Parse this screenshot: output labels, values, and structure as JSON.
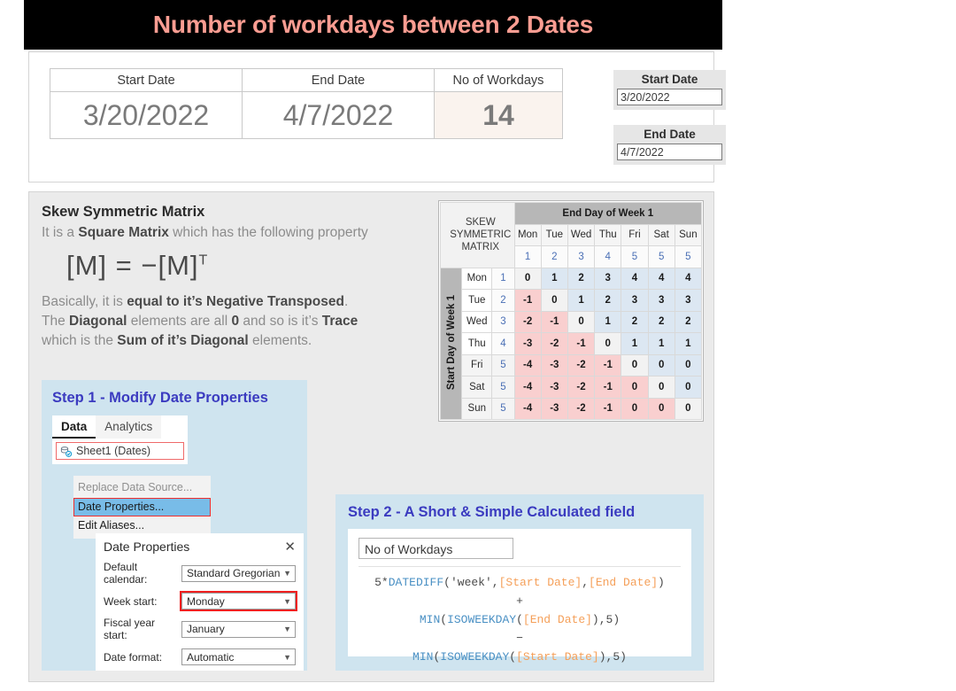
{
  "title": "Number of workdays between 2 Dates",
  "summary": {
    "headers": [
      "Start Date",
      "End Date",
      "No of Workdays"
    ],
    "values": [
      "3/20/2022",
      "4/7/2022",
      "14"
    ],
    "workdays_bg": "#faf3ee",
    "workdays_color": "#d58080"
  },
  "parameters": [
    {
      "name": "param-start-date",
      "label": "Start Date",
      "value": "3/20/2022"
    },
    {
      "name": "param-end-date",
      "label": "End Date",
      "value": "4/7/2022"
    }
  ],
  "explanation": {
    "heading": "Skew Symmetric Matrix",
    "line1_a": "It is a ",
    "line1_b": "Square Matrix",
    "line1_c": " which has the following property",
    "formula_left": "[M]  =  −[M]",
    "formula_sup": "T",
    "line2_a": "Basically, it is ",
    "line2_b": "equal to it’s Negative Transposed",
    "line2_c": ".",
    "line3_a": "The ",
    "line3_b": "Diagonal",
    "line3_c": " elements are all ",
    "line3_d": "0",
    "line3_e": " and so is it’s ",
    "line3_f": "Trace",
    "line4_a": "which is the ",
    "line4_b": "Sum of it’s Diagonal",
    "line4_c": " elements."
  },
  "matrix": {
    "corner_title": "SKEW SYMMETRIC MATRIX",
    "col_group_label": "End Day of Week 1",
    "row_group_label": "Start Day of Week 1",
    "col_days": [
      "Mon",
      "Tue",
      "Wed",
      "Thu",
      "Fri",
      "Sat",
      "Sun"
    ],
    "col_nums": [
      "1",
      "2",
      "3",
      "4",
      "5",
      "5",
      "5"
    ],
    "row_days": [
      "Mon",
      "Tue",
      "Wed",
      "Thu",
      "Fri",
      "Sat",
      "Sun"
    ],
    "row_nums": [
      "1",
      "2",
      "3",
      "4",
      "5",
      "5",
      "5"
    ],
    "rows": [
      [
        "0",
        "1",
        "2",
        "3",
        "4",
        "4",
        "4"
      ],
      [
        "-1",
        "0",
        "1",
        "2",
        "3",
        "3",
        "3"
      ],
      [
        "-2",
        "-1",
        "0",
        "1",
        "2",
        "2",
        "2"
      ],
      [
        "-3",
        "-2",
        "-1",
        "0",
        "1",
        "1",
        "1"
      ],
      [
        "-4",
        "-3",
        "-2",
        "-1",
        "0",
        "0",
        "0"
      ],
      [
        "-4",
        "-3",
        "-2",
        "-1",
        "0",
        "0",
        "0"
      ],
      [
        "-4",
        "-3",
        "-2",
        "-1",
        "0",
        "0",
        "0"
      ]
    ],
    "colors": {
      "positive": "#dce7f2",
      "negative": "#f9cfcf",
      "zero": "#f2f2f2",
      "group_header": "#b7b7b7"
    }
  },
  "step1": {
    "heading": "Step 1 - Modify Date Properties",
    "tabs": [
      {
        "label": "Data",
        "active": true
      },
      {
        "label": "Analytics",
        "active": false
      }
    ],
    "data_source": "Sheet1 (Dates)",
    "menu": [
      {
        "label": "Replace Data Source...",
        "state": "disabled"
      },
      {
        "label": "Date Properties...",
        "state": "selected"
      },
      {
        "label": "Edit Aliases...",
        "state": "enabled"
      }
    ],
    "dialog": {
      "title": "Date Properties",
      "close_label": "✕",
      "rows": [
        {
          "label": "Default calendar:",
          "value": "Standard Gregorian",
          "highlight": false
        },
        {
          "label": "Week start:",
          "value": "Monday",
          "highlight": true
        },
        {
          "label": "Fiscal year start:",
          "value": "January",
          "highlight": false
        },
        {
          "label": "Date format:",
          "value": "Automatic",
          "highlight": false
        }
      ]
    }
  },
  "step2": {
    "heading": "Step 2 - A Short & Simple Calculated field",
    "field_name": "No of Workdays",
    "code_lines": [
      [
        {
          "t": "5*",
          "c": "plain"
        },
        {
          "t": "DATEDIFF",
          "c": "fn"
        },
        {
          "t": "(",
          "c": "plain"
        },
        {
          "t": "'week'",
          "c": "str"
        },
        {
          "t": ",",
          "c": "plain"
        },
        {
          "t": "[Start Date]",
          "c": "field"
        },
        {
          "t": ",",
          "c": "plain"
        },
        {
          "t": "[End Date]",
          "c": "field"
        },
        {
          "t": ")",
          "c": "plain"
        }
      ],
      [
        {
          "t": "+",
          "c": "op"
        }
      ],
      [
        {
          "t": "MIN",
          "c": "fn"
        },
        {
          "t": "(",
          "c": "plain"
        },
        {
          "t": "ISOWEEKDAY",
          "c": "fn"
        },
        {
          "t": "(",
          "c": "plain"
        },
        {
          "t": "[End Date]",
          "c": "field"
        },
        {
          "t": ")",
          "c": "plain"
        },
        {
          "t": ",5)",
          "c": "plain"
        }
      ],
      [
        {
          "t": "−",
          "c": "op"
        }
      ],
      [
        {
          "t": "MIN",
          "c": "fn"
        },
        {
          "t": "(",
          "c": "plain"
        },
        {
          "t": "ISOWEEKDAY",
          "c": "fn"
        },
        {
          "t": "(",
          "c": "plain"
        },
        {
          "t": "[Start Date]",
          "c": "field"
        },
        {
          "t": ")",
          "c": "plain"
        },
        {
          "t": ",5)",
          "c": "plain"
        }
      ]
    ]
  }
}
